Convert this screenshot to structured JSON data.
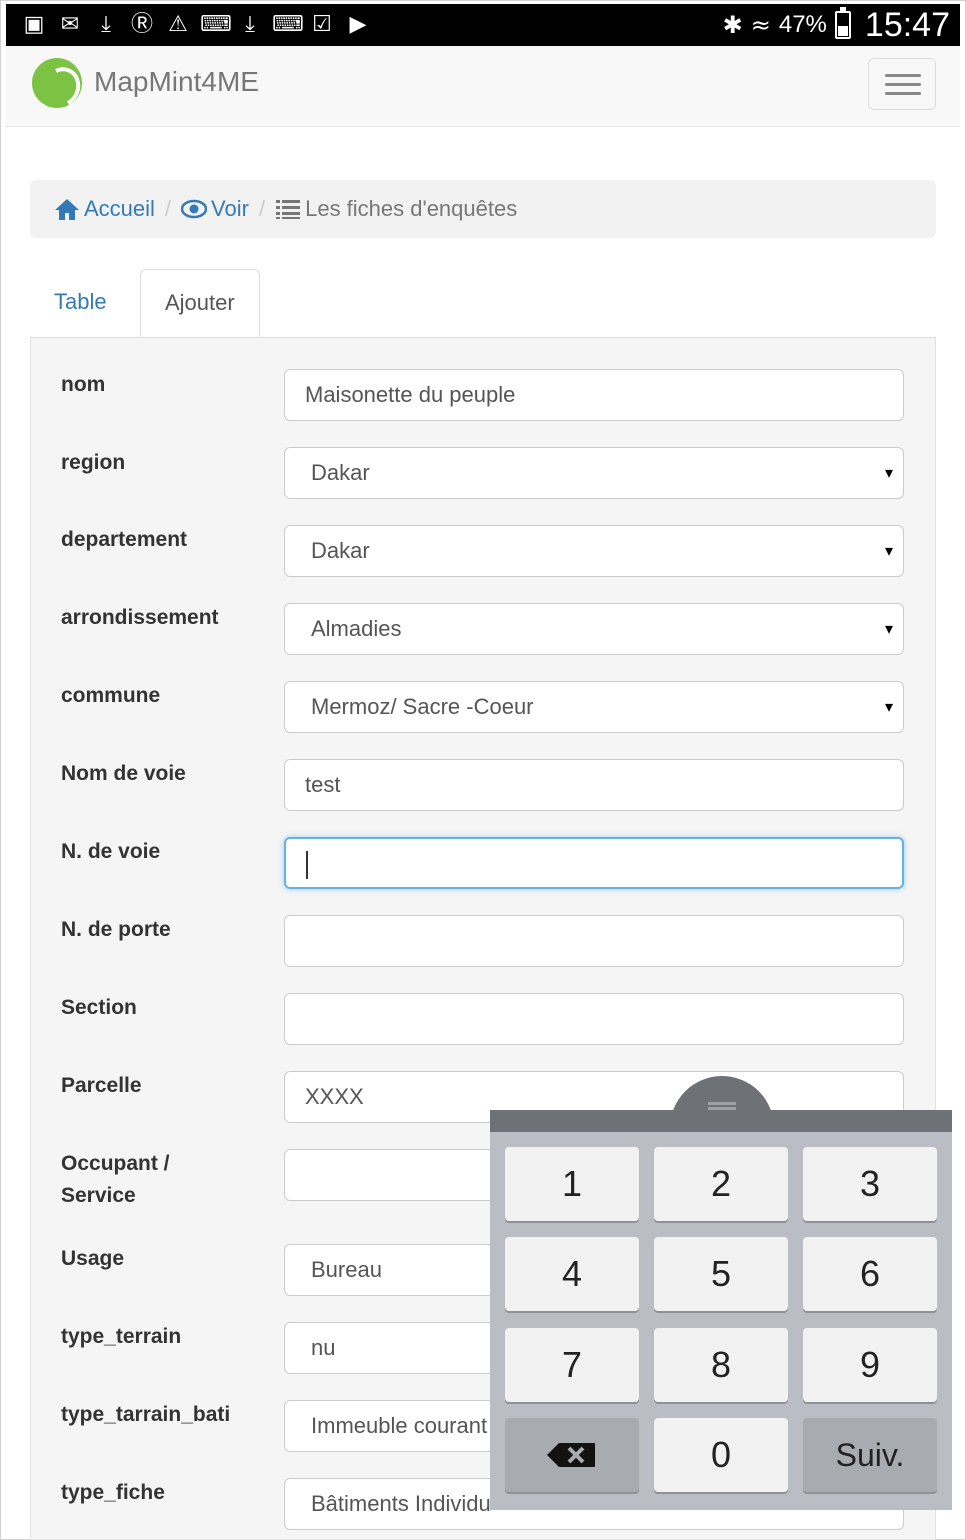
{
  "status_bar": {
    "left_icons": [
      "picture-icon",
      "email-icon",
      "download-icon",
      "skype-icon",
      "warning-icon",
      "keyboard-icon",
      "download-icon",
      "google-plus-icon",
      "clipboard-check-icon",
      "youtube-icon"
    ],
    "battery": "47%",
    "battery_level": 0.47,
    "time": "15:47"
  },
  "navbar": {
    "brand": "MapMint4ME"
  },
  "breadcrumb": {
    "home": "Accueil",
    "view": "Voir",
    "current": "Les fiches d'enquêtes"
  },
  "tabs": {
    "table": "Table",
    "add": "Ajouter"
  },
  "form": {
    "nom": {
      "label": "nom",
      "value": "Maisonette du peuple"
    },
    "region": {
      "label": "region",
      "value": "Dakar"
    },
    "departement": {
      "label": "departement",
      "value": "Dakar"
    },
    "arrondissement": {
      "label": "arrondissement",
      "value": "Almadies"
    },
    "commune": {
      "label": "commune",
      "value": "Mermoz/ Sacre -Coeur"
    },
    "nom_voie": {
      "label": "Nom de voie",
      "value": "test"
    },
    "n_voie": {
      "label": "N. de voie",
      "value": ""
    },
    "n_porte": {
      "label": "N. de porte",
      "value": ""
    },
    "section": {
      "label": "Section",
      "value": ""
    },
    "parcelle": {
      "label": "Parcelle",
      "value": "XXXX"
    },
    "occupant": {
      "label_line1": "Occupant /",
      "label_line2": "Service",
      "value": ""
    },
    "usage": {
      "label": "Usage",
      "value": "Bureau"
    },
    "type_terrain": {
      "label": "type_terrain",
      "value": "nu"
    },
    "type_tarrain_bati": {
      "label": "type_tarrain_bati",
      "value": "Immeuble courant"
    },
    "type_fiche": {
      "label": "type_fiche",
      "value": "Bâtiments Individu"
    }
  },
  "keyboard": {
    "keys": [
      "1",
      "2",
      "3",
      "4",
      "5",
      "6",
      "7",
      "8",
      "9",
      "0"
    ],
    "next_label": "Suiv."
  }
}
